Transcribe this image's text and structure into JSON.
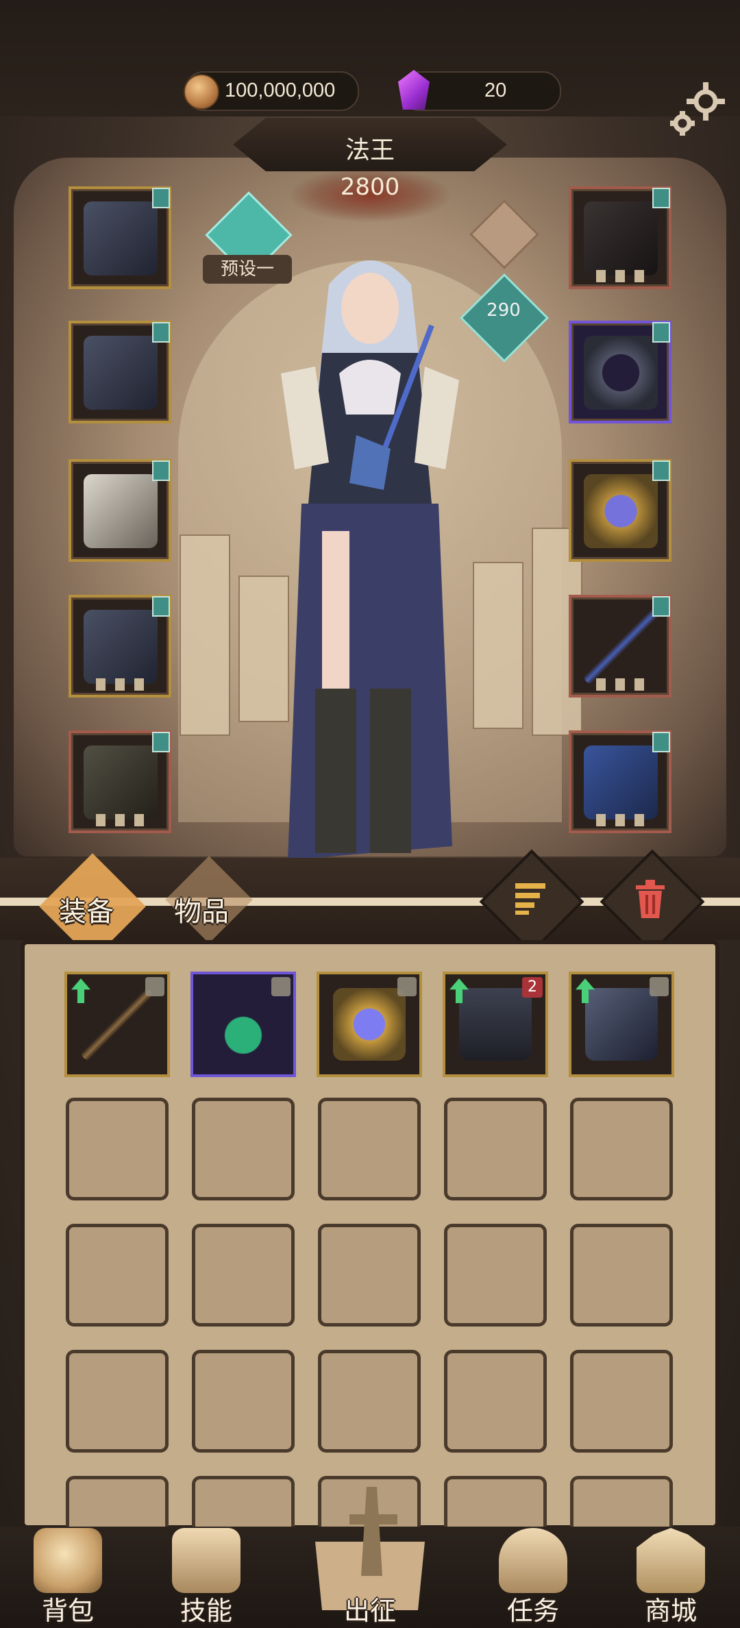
{
  "currency": {
    "coins": "100,000,000",
    "gems": "20"
  },
  "hero": {
    "class_name": "法王",
    "power": "2800",
    "preset_label": "预设一",
    "level": "290"
  },
  "tabs": {
    "equipment": "装备",
    "items": "物品"
  },
  "equipment_slots": {
    "left": [
      {
        "name": "helmet",
        "frame": "gold"
      },
      {
        "name": "armor",
        "frame": "gold"
      },
      {
        "name": "gloves",
        "frame": "gold"
      },
      {
        "name": "pants",
        "frame": "gold"
      },
      {
        "name": "boots",
        "frame": "red"
      }
    ],
    "right": [
      {
        "name": "necklace",
        "frame": "red"
      },
      {
        "name": "ring",
        "frame": "purple"
      },
      {
        "name": "amulet",
        "frame": "gold"
      },
      {
        "name": "staff",
        "frame": "red"
      },
      {
        "name": "shield",
        "frame": "red"
      }
    ]
  },
  "inventory": {
    "items": [
      {
        "name": "staff",
        "upgrade": true,
        "locked": true
      },
      {
        "name": "emerald-pendant",
        "upgrade": false,
        "locked": true
      },
      {
        "name": "sapphire-ring",
        "upgrade": false,
        "locked": true
      },
      {
        "name": "helm",
        "upgrade": true,
        "badge": "2"
      },
      {
        "name": "gauntlet",
        "upgrade": true,
        "locked": true
      }
    ]
  },
  "nav": {
    "backpack": "背包",
    "skills": "技能",
    "expedition": "出征",
    "quests": "任务",
    "shop": "商城"
  },
  "colors": {
    "gold_frame": "#b48f3e",
    "purple_frame": "#6f56d9",
    "red_frame": "#a25b4c",
    "teal": "#3f8f86",
    "upgrade_arrow": "#49d079"
  }
}
